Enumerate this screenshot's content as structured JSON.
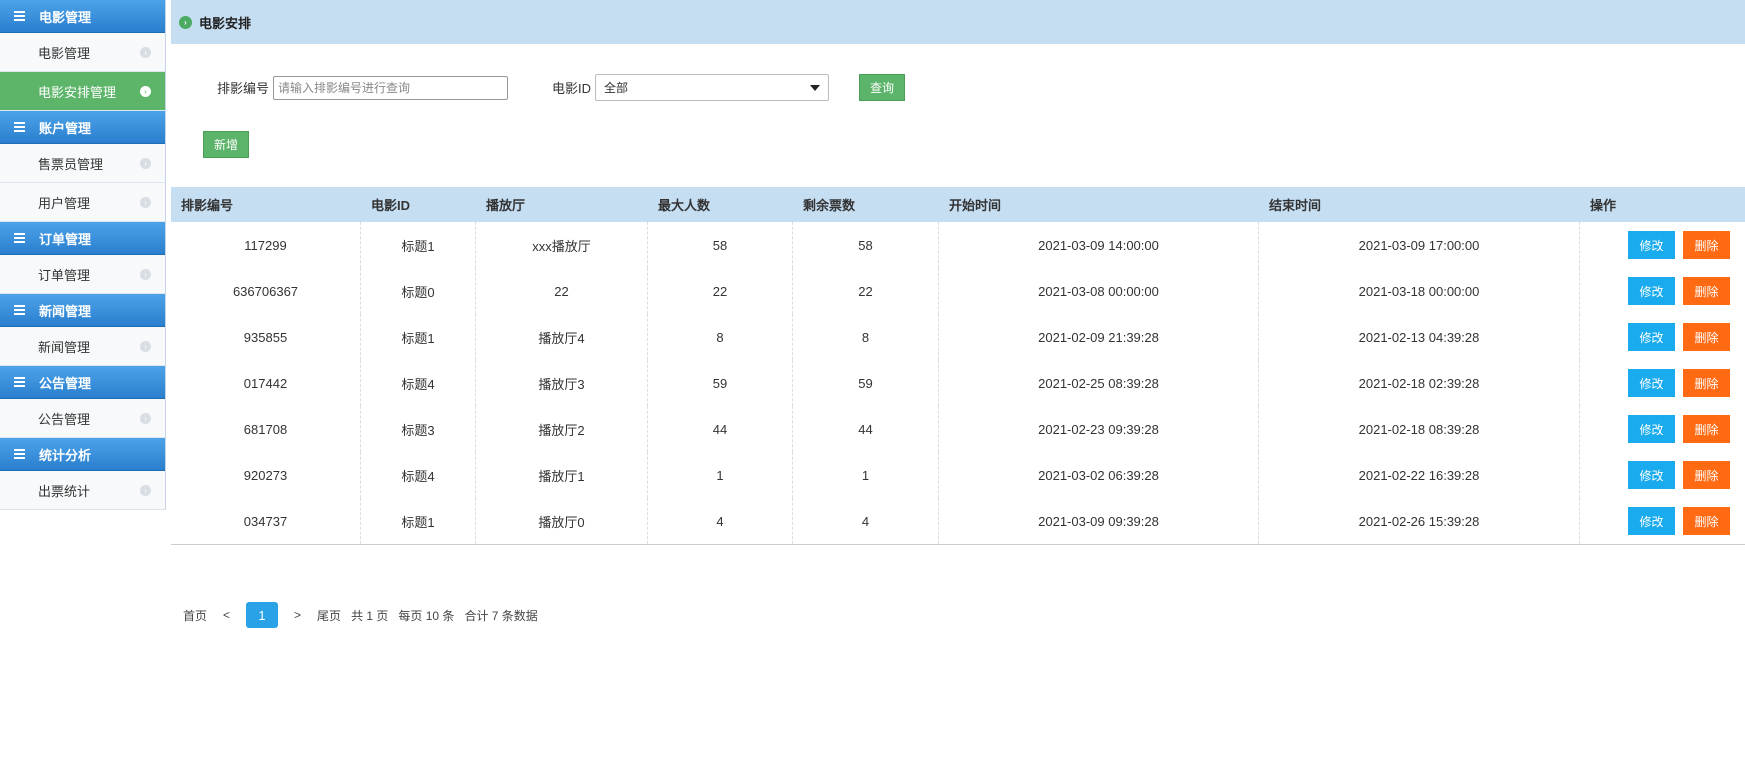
{
  "sidebar": {
    "groups": [
      {
        "title": "电影管理",
        "items": [
          {
            "label": "电影管理",
            "active": false
          },
          {
            "label": "电影安排管理",
            "active": true
          }
        ]
      },
      {
        "title": "账户管理",
        "items": [
          {
            "label": "售票员管理",
            "active": false
          },
          {
            "label": "用户管理",
            "active": false
          }
        ]
      },
      {
        "title": "订单管理",
        "items": [
          {
            "label": "订单管理",
            "active": false
          }
        ]
      },
      {
        "title": "新闻管理",
        "items": [
          {
            "label": "新闻管理",
            "active": false
          }
        ]
      },
      {
        "title": "公告管理",
        "items": [
          {
            "label": "公告管理",
            "active": false
          }
        ]
      },
      {
        "title": "统计分析",
        "items": [
          {
            "label": "出票统计",
            "active": false
          }
        ]
      }
    ]
  },
  "header": {
    "title": "电影安排"
  },
  "filters": {
    "id_label": "排影编号",
    "id_placeholder": "请输入排影编号进行查询",
    "movie_label": "电影ID",
    "movie_value": "全部",
    "search_label": "查询",
    "add_label": "新增"
  },
  "table": {
    "headers": [
      "排影编号",
      "电影ID",
      "播放厅",
      "最大人数",
      "剩余票数",
      "开始时间",
      "结束时间",
      "操作"
    ],
    "edit_label": "修改",
    "delete_label": "删除",
    "rows": [
      [
        "117299",
        "标题1",
        "xxx播放厅",
        "58",
        "58",
        "2021-03-09 14:00:00",
        "2021-03-09 17:00:00"
      ],
      [
        "636706367",
        "标题0",
        "22",
        "22",
        "22",
        "2021-03-08 00:00:00",
        "2021-03-18 00:00:00"
      ],
      [
        "935855",
        "标题1",
        "播放厅4",
        "8",
        "8",
        "2021-02-09 21:39:28",
        "2021-02-13 04:39:28"
      ],
      [
        "017442",
        "标题4",
        "播放厅3",
        "59",
        "59",
        "2021-02-25 08:39:28",
        "2021-02-18 02:39:28"
      ],
      [
        "681708",
        "标题3",
        "播放厅2",
        "44",
        "44",
        "2021-02-23 09:39:28",
        "2021-02-18 08:39:28"
      ],
      [
        "920273",
        "标题4",
        "播放厅1",
        "1",
        "1",
        "2021-03-02 06:39:28",
        "2021-02-22 16:39:28"
      ],
      [
        "034737",
        "标题1",
        "播放厅0",
        "4",
        "4",
        "2021-03-09 09:39:28",
        "2021-02-26 15:39:28"
      ]
    ]
  },
  "pager": {
    "first": "首页",
    "prev": "<",
    "current": "1",
    "next": ">",
    "last": "尾页",
    "total_pages": "共 1 页",
    "per_page": "每页 10 条",
    "total": "合计 7 条数据"
  },
  "colors": {
    "header_bg": "#c6def2",
    "sidebar_head": "#2a7fcf",
    "active_green": "#5db56a",
    "edit_blue": "#1aabee",
    "delete_orange": "#ff6a13"
  }
}
